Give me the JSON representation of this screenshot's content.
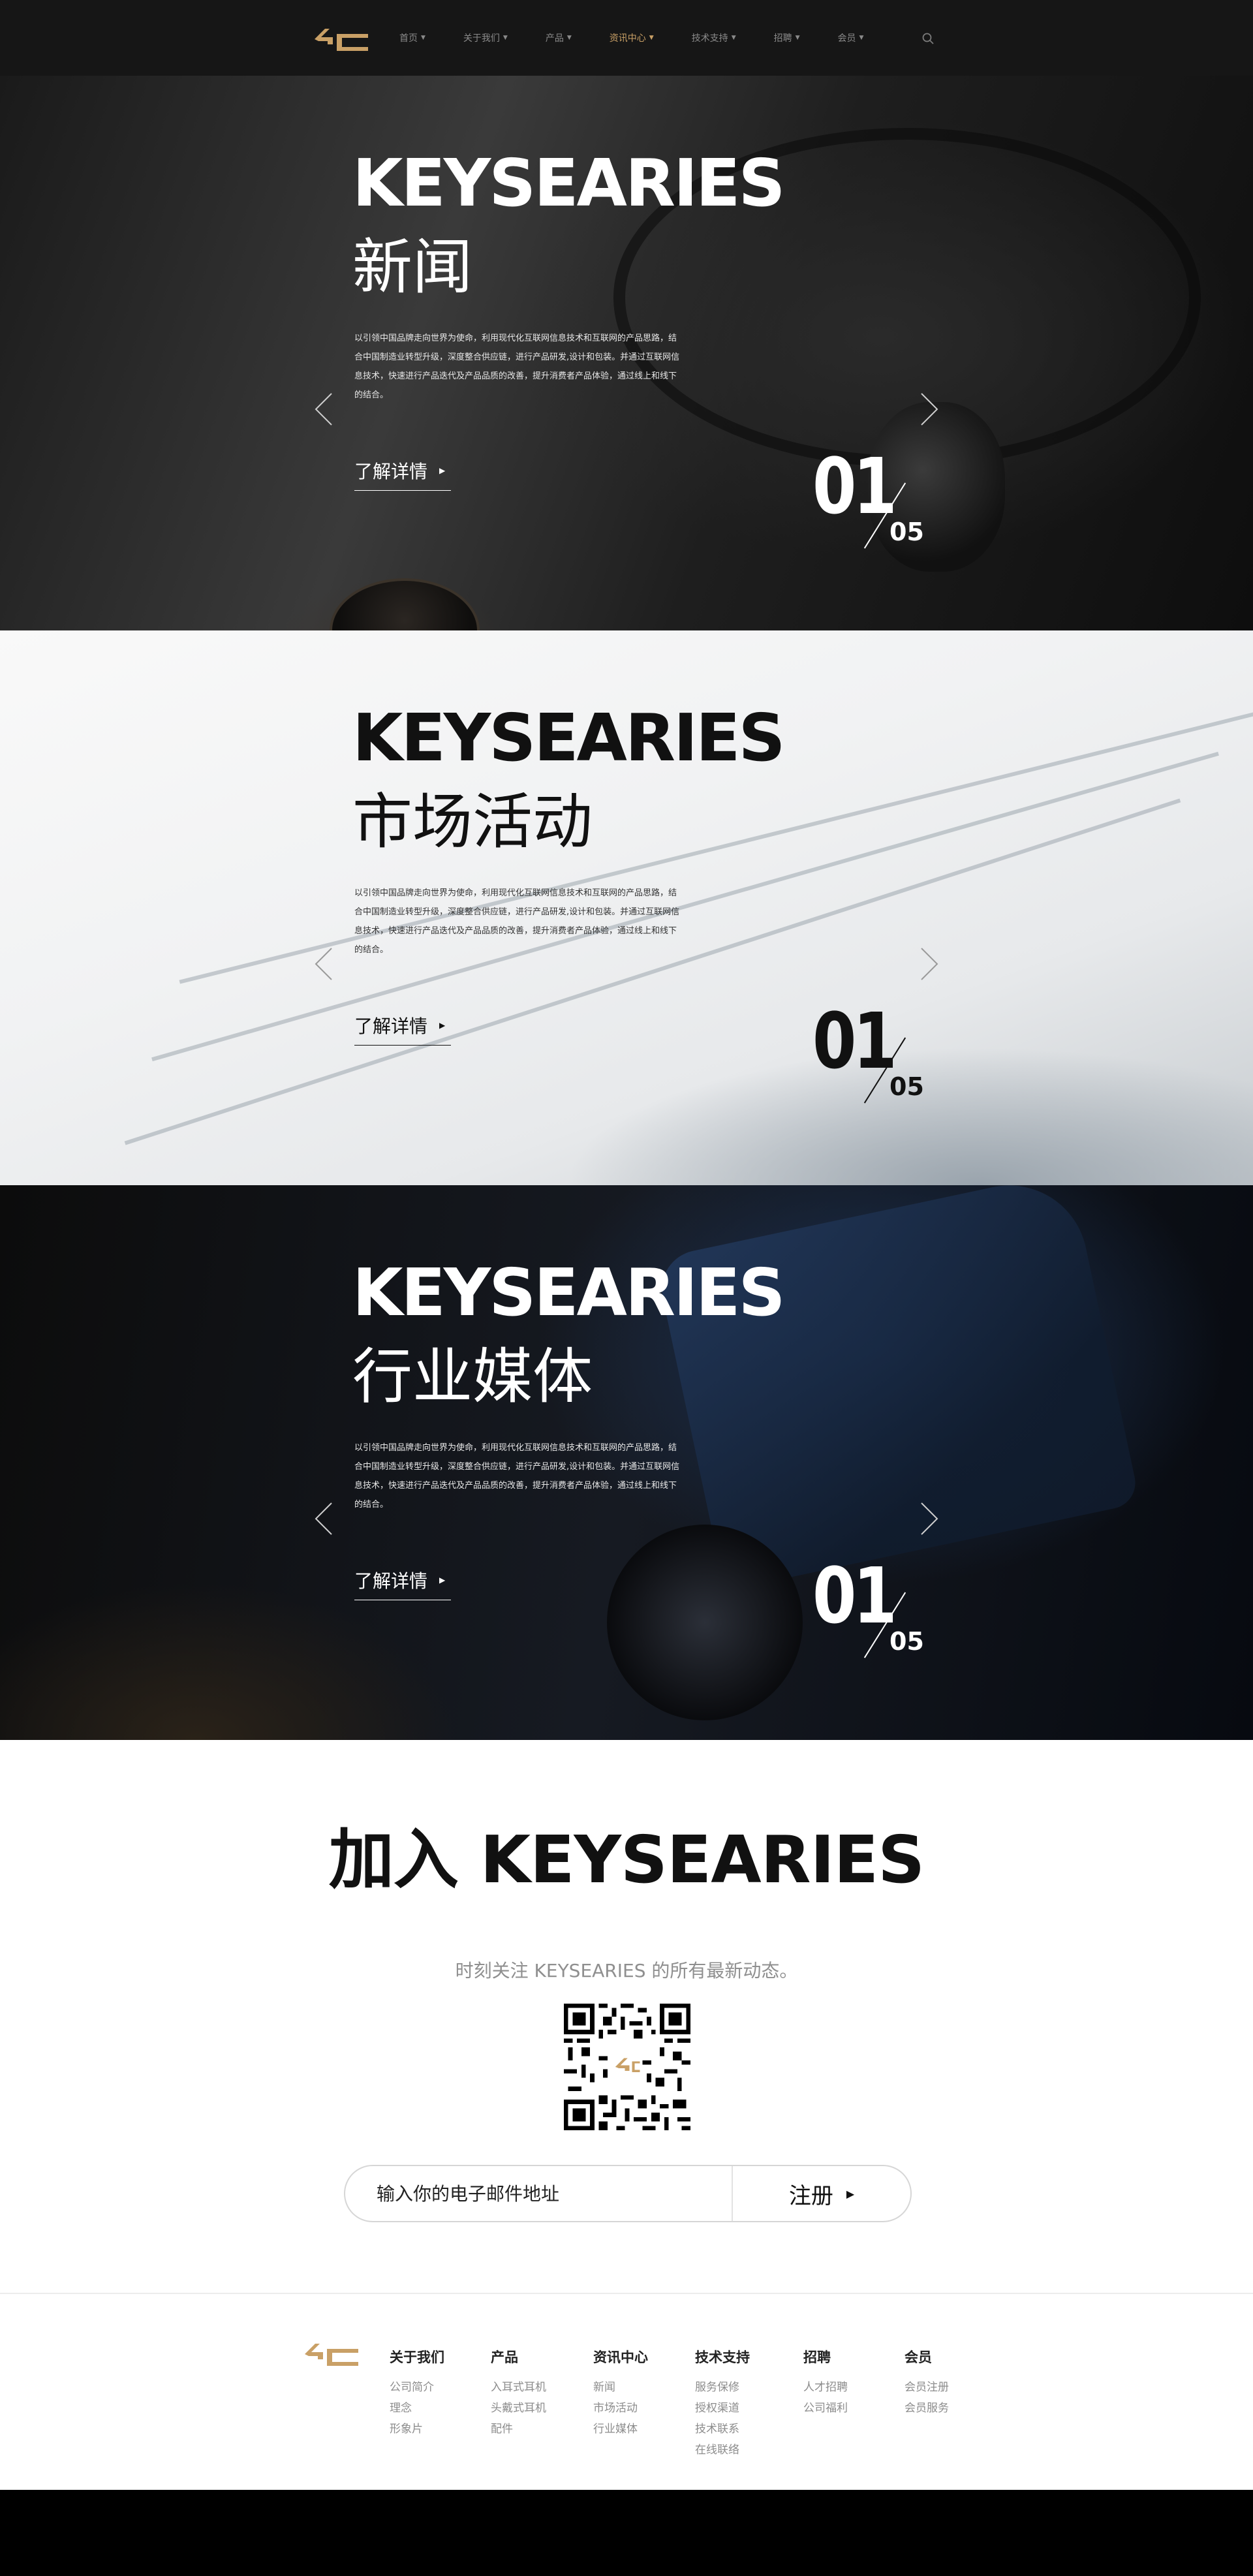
{
  "header": {
    "nav": [
      {
        "label": "首页"
      },
      {
        "label": "关于我们"
      },
      {
        "label": "产品"
      },
      {
        "label": "资讯中心",
        "active": true
      },
      {
        "label": "技术支持"
      },
      {
        "label": "招聘"
      },
      {
        "label": "会员"
      }
    ],
    "accent_color": "#c9a066"
  },
  "slides": [
    {
      "title_en": "KEYSEARIES",
      "title_cn": "新闻",
      "description": "以引领中国品牌走向世界为使命，利用现代化互联网信息技术和互联网的产品思路，结合中国制造业转型升级，深度整合供应链，进行产品研发,设计和包装。并通过互联网信息技术，快速进行产品迭代及产品品质的改善，提升消费者产品体验，通过线上和线下的结合。",
      "more_label": "了解详情",
      "current": "01",
      "total": "05",
      "theme": "dark"
    },
    {
      "title_en": "KEYSEARIES",
      "title_cn": "市场活动",
      "description": "以引领中国品牌走向世界为使命，利用现代化互联网信息技术和互联网的产品思路，结合中国制造业转型升级，深度整合供应链，进行产品研发,设计和包装。并通过互联网信息技术，快速进行产品迭代及产品品质的改善，提升消费者产品体验，通过线上和线下的结合。",
      "more_label": "了解详情",
      "current": "01",
      "total": "05",
      "theme": "light"
    },
    {
      "title_en": "KEYSEARIES",
      "title_cn": "行业媒体",
      "description": "以引领中国品牌走向世界为使命，利用现代化互联网信息技术和互联网的产品思路，结合中国制造业转型升级，深度整合供应链，进行产品研发,设计和包装。并通过互联网信息技术，快速进行产品迭代及产品品质的改善，提升消费者产品体验，通过线上和线下的结合。",
      "more_label": "了解详情",
      "current": "01",
      "total": "05",
      "theme": "dark"
    }
  ],
  "join": {
    "title": "加入 KEYSEARIES",
    "subtitle": "时刻关注 KEYSEARIES 的所有最新动态。",
    "email_placeholder": "输入你的电子邮件地址",
    "signup_label": "注册"
  },
  "footer": {
    "columns": [
      {
        "heading": "关于我们",
        "links": [
          "公司简介",
          "理念",
          "形象片"
        ]
      },
      {
        "heading": "产品",
        "links": [
          "入耳式耳机",
          "头戴式耳机",
          "配件"
        ]
      },
      {
        "heading": "资讯中心",
        "links": [
          "新闻",
          "市场活动",
          "行业媒体"
        ]
      },
      {
        "heading": "技术支持",
        "links": [
          "服务保修",
          "授权渠道",
          "技术联系",
          "在线联络"
        ]
      },
      {
        "heading": "招聘",
        "links": [
          "人才招聘",
          "公司福利"
        ]
      },
      {
        "heading": "会员",
        "links": [
          "会员注册",
          "会员服务"
        ]
      }
    ]
  },
  "icons": {
    "logo": "brand-logo-icon",
    "search": "search-icon",
    "prev": "chevron-left-icon",
    "next": "chevron-right-icon",
    "qr": "qr-code-icon"
  }
}
